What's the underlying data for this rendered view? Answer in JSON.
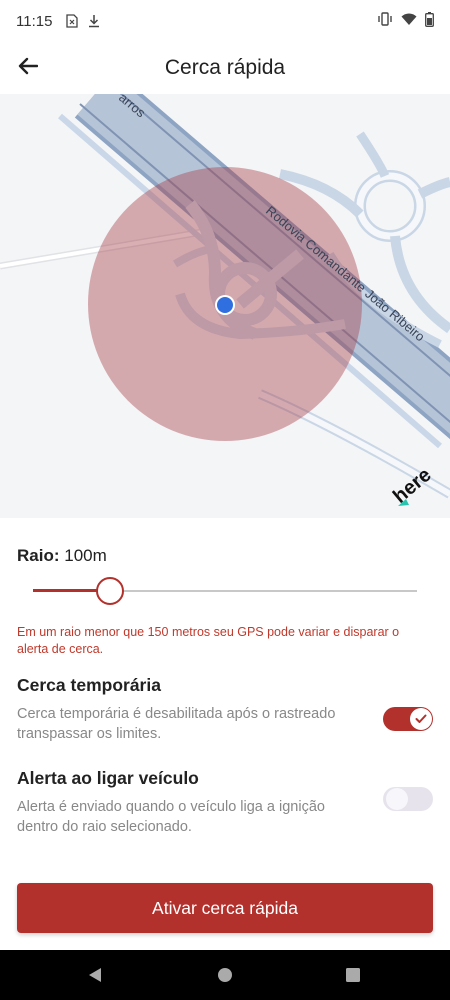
{
  "status_bar": {
    "time": "11:15",
    "icons_left": [
      "sim-icon",
      "download-icon"
    ],
    "icons_right": [
      "vibrate-icon",
      "wifi-icon",
      "battery-icon"
    ]
  },
  "header": {
    "title": "Cerca rápida",
    "back_icon": "arrow-back-icon"
  },
  "map": {
    "road_label_1": "Rodovia Comandante João Ribeiro",
    "road_label_2": "arros",
    "provider_logo": "here",
    "circle_color": "#a7414a",
    "location_color": "#2f6fe0"
  },
  "radius": {
    "label": "Raio:",
    "value": "100m",
    "slider_fraction": 0.2
  },
  "warning": "Em um raio menor que 150 metros seu GPS pode variar e disparar o alerta de cerca.",
  "options": [
    {
      "title": "Cerca temporária",
      "description": "Cerca temporária é desabilitada após o rastreado transpassar os limites.",
      "enabled": true
    },
    {
      "title": "Alerta ao ligar veículo",
      "description": "Alerta é enviado quando o veículo liga a ignição dentro do raio selecionado.",
      "enabled": false
    }
  ],
  "cta": {
    "label": "Ativar cerca rápida"
  },
  "colors": {
    "accent": "#b3312c",
    "warning": "#c0392b"
  },
  "nav": {
    "back": "nav-back-icon",
    "home": "nav-home-icon",
    "recents": "nav-recents-icon"
  }
}
